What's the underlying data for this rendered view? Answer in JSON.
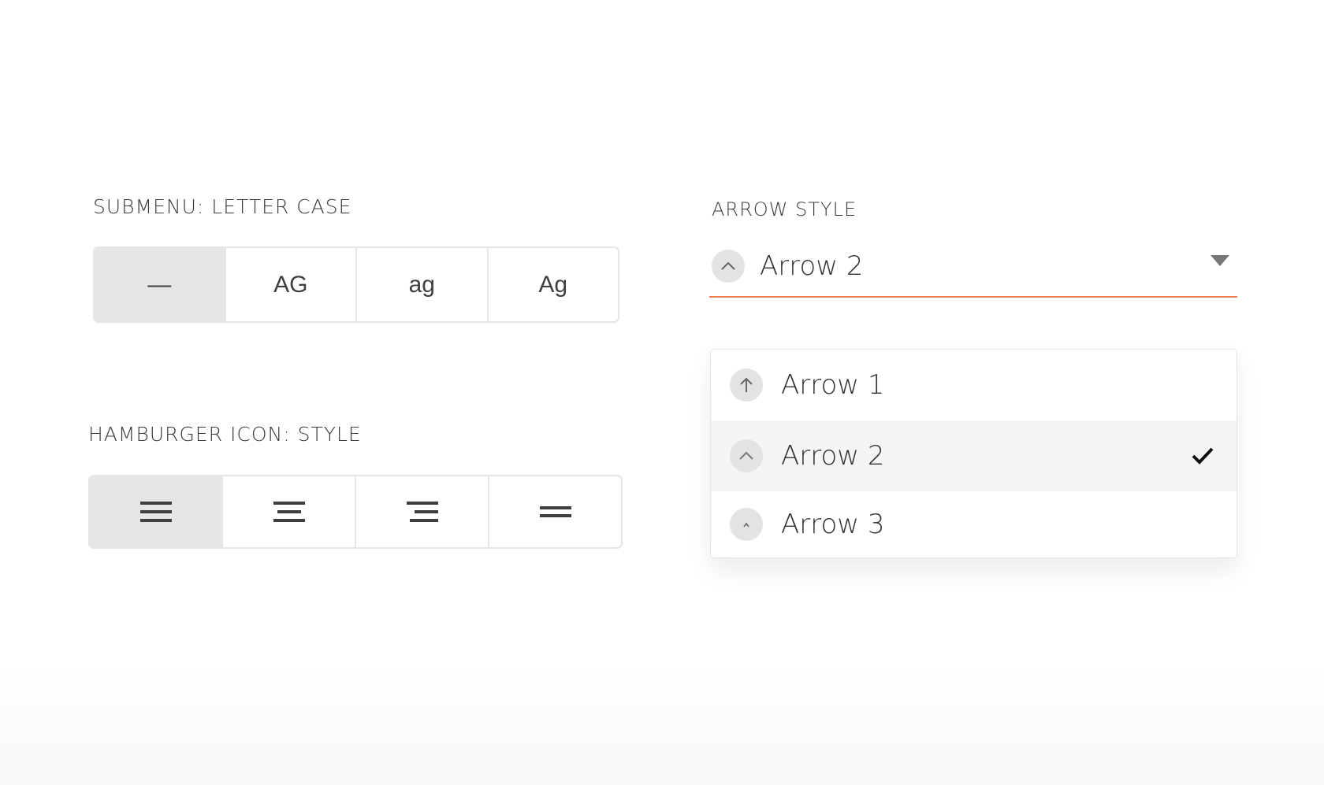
{
  "letter_case": {
    "label": "SUBMENU: LETTER CASE",
    "options": [
      "—",
      "AG",
      "ag",
      "Ag"
    ],
    "selected_index": 0
  },
  "hamburger": {
    "label": "HAMBURGER ICON: STYLE",
    "options": [
      {
        "icon": "hamburger-full-icon"
      },
      {
        "icon": "hamburger-centered-icon"
      },
      {
        "icon": "hamburger-right-aligned-icon"
      },
      {
        "icon": "two-line-icon"
      }
    ],
    "selected_index": 0
  },
  "arrow_style": {
    "label": "ARROW STYLE",
    "selected_value": "Arrow 2",
    "selected_icon": "chevron-up-icon",
    "caret_icon": "caret-down-icon",
    "underline_color": "#ee7f55",
    "options": [
      {
        "label": "Arrow 1",
        "icon": "arrow-up-icon"
      },
      {
        "label": "Arrow 2",
        "icon": "chevron-up-icon",
        "selected": true
      },
      {
        "label": "Arrow 3",
        "icon": "small-chevron-up-icon"
      }
    ],
    "check_icon": "checkmark-icon"
  }
}
